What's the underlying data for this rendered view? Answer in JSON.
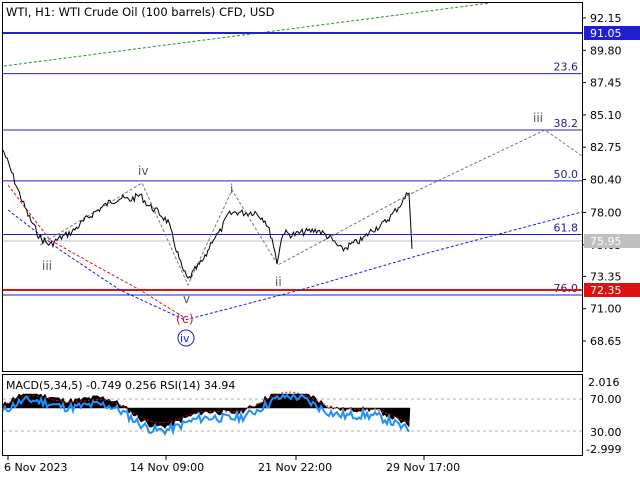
{
  "header": {
    "title": "WTI, H1:  WTI Crude Oil (100 barrels) CFD, USD"
  },
  "price_axis": {
    "ticks": [
      "92.15",
      "89.80",
      "87.45",
      "85.10",
      "82.75",
      "80.40",
      "78.00",
      "75.65",
      "73.35",
      "71.00",
      "68.65"
    ],
    "tick_values": [
      92.15,
      89.8,
      87.45,
      85.1,
      82.75,
      80.4,
      78.0,
      75.65,
      73.35,
      71.0,
      68.65
    ],
    "current_price": "75.95",
    "level_high": "91.05",
    "level_low": "72.35"
  },
  "fib_levels": [
    {
      "label": "23.6",
      "value": 88.1
    },
    {
      "label": "38.2",
      "value": 84.0
    },
    {
      "label": "50.0",
      "value": 80.3
    },
    {
      "label": "61.8",
      "value": 76.4
    },
    {
      "label": "76.0",
      "value": 72.0
    }
  ],
  "wave_labels": {
    "upper": [
      "iii",
      "iv",
      "i",
      "ii",
      "v",
      "iii"
    ],
    "circled": [
      "c",
      "iv"
    ]
  },
  "indicator": {
    "title": "MACD(5,34,5) -0.749 0.256 RSI(14) 34.94",
    "ticks": [
      "2.016",
      "70.00",
      "30.00",
      "-2.999"
    ]
  },
  "time_axis": {
    "labels": [
      "6 Nov 2023",
      "14 Nov 09:00",
      "21 Nov 22:00",
      "29 Nov 17:00"
    ]
  },
  "colors": {
    "blue_level": "#1f1fcf",
    "red_level": "#e01010",
    "current_bg": "#c0c0c0",
    "rsi": "#1e90ff",
    "macd": "#000000"
  }
}
